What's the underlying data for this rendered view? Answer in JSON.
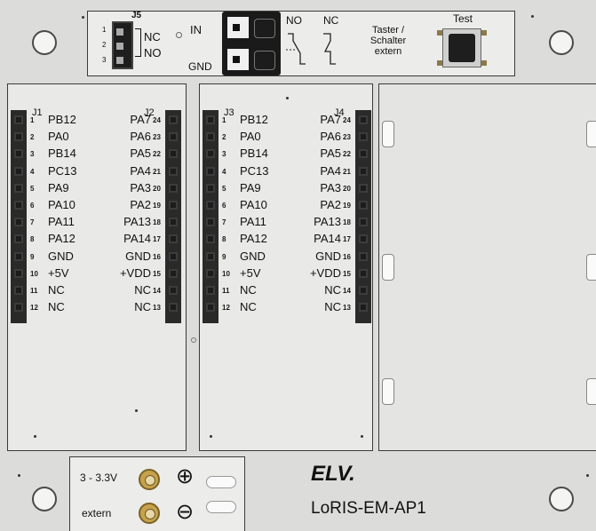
{
  "top": {
    "jumper_label": "J5",
    "jumper_pins": [
      "1",
      "2",
      "3"
    ],
    "jumper_nc": "NC",
    "jumper_no": "NO",
    "in_label": "IN",
    "gnd_label": "GND",
    "no_label": "NO",
    "nc_label": "NC",
    "taster_label": "Taster /\nSchalter\nextern",
    "test_label": "Test"
  },
  "headers": [
    {
      "label": "J1",
      "pins": [
        "1",
        "2",
        "3",
        "4",
        "5",
        "6",
        "7",
        "8",
        "9",
        "10",
        "11",
        "12"
      ],
      "names": [
        "PB12",
        "PA0",
        "PB14",
        "PC13",
        "PA9",
        "PA10",
        "PA11",
        "PA12",
        "GND",
        "+5V",
        "NC",
        "NC"
      ]
    },
    {
      "label": "J2",
      "pins": [
        "24",
        "23",
        "22",
        "21",
        "20",
        "19",
        "18",
        "17",
        "16",
        "15",
        "14",
        "13"
      ],
      "names": [
        "PA7",
        "PA6",
        "PA5",
        "PA4",
        "PA3",
        "PA2",
        "PA13",
        "PA14",
        "GND",
        "+VDD",
        "NC",
        "NC"
      ]
    },
    {
      "label": "J3",
      "pins": [
        "1",
        "2",
        "3",
        "4",
        "5",
        "6",
        "7",
        "8",
        "9",
        "10",
        "11",
        "12"
      ],
      "names": [
        "PB12",
        "PA0",
        "PB14",
        "PC13",
        "PA9",
        "PA10",
        "PA11",
        "PA12",
        "GND",
        "+5V",
        "NC",
        "NC"
      ]
    },
    {
      "label": "J4",
      "pins": [
        "24",
        "23",
        "22",
        "21",
        "20",
        "19",
        "18",
        "17",
        "16",
        "15",
        "14",
        "13"
      ],
      "names": [
        "PA7",
        "PA6",
        "PA5",
        "PA4",
        "PA3",
        "PA2",
        "PA13",
        "PA14",
        "GND",
        "+VDD",
        "NC",
        "NC"
      ]
    }
  ],
  "power": {
    "volt_label": "3 - 3.3V",
    "extern_label": "extern",
    "plus": "⊕",
    "minus": "⊖"
  },
  "brand": {
    "logo": "ELV.",
    "product": "LoRIS-EM-AP1"
  }
}
